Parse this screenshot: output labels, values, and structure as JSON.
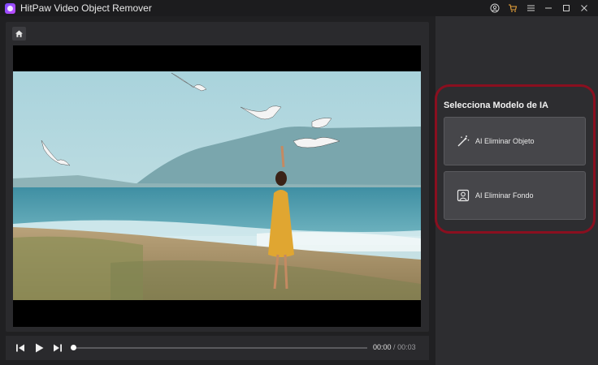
{
  "app": {
    "title": "HitPaw Video Object Remover"
  },
  "titlebar_icons": [
    "account-icon",
    "cart-icon",
    "menu-icon",
    "minimize-icon",
    "maximize-icon",
    "close-icon"
  ],
  "player": {
    "current_time": "00:00",
    "separator": "/",
    "duration": "00:03",
    "progress": 0
  },
  "side_panel": {
    "title": "Selecciona Modelo de IA",
    "models": [
      {
        "label": "AI Eliminar Objeto",
        "icon": "magic-wand-icon"
      },
      {
        "label": "AI Eliminar Fondo",
        "icon": "portrait-icon"
      }
    ]
  },
  "colors": {
    "accent_highlight": "#8a0f1f",
    "window_bg": "#202022",
    "panel_bg": "#2d2d30",
    "card_bg": "#46464a",
    "cart_icon": "#e8a23a"
  }
}
